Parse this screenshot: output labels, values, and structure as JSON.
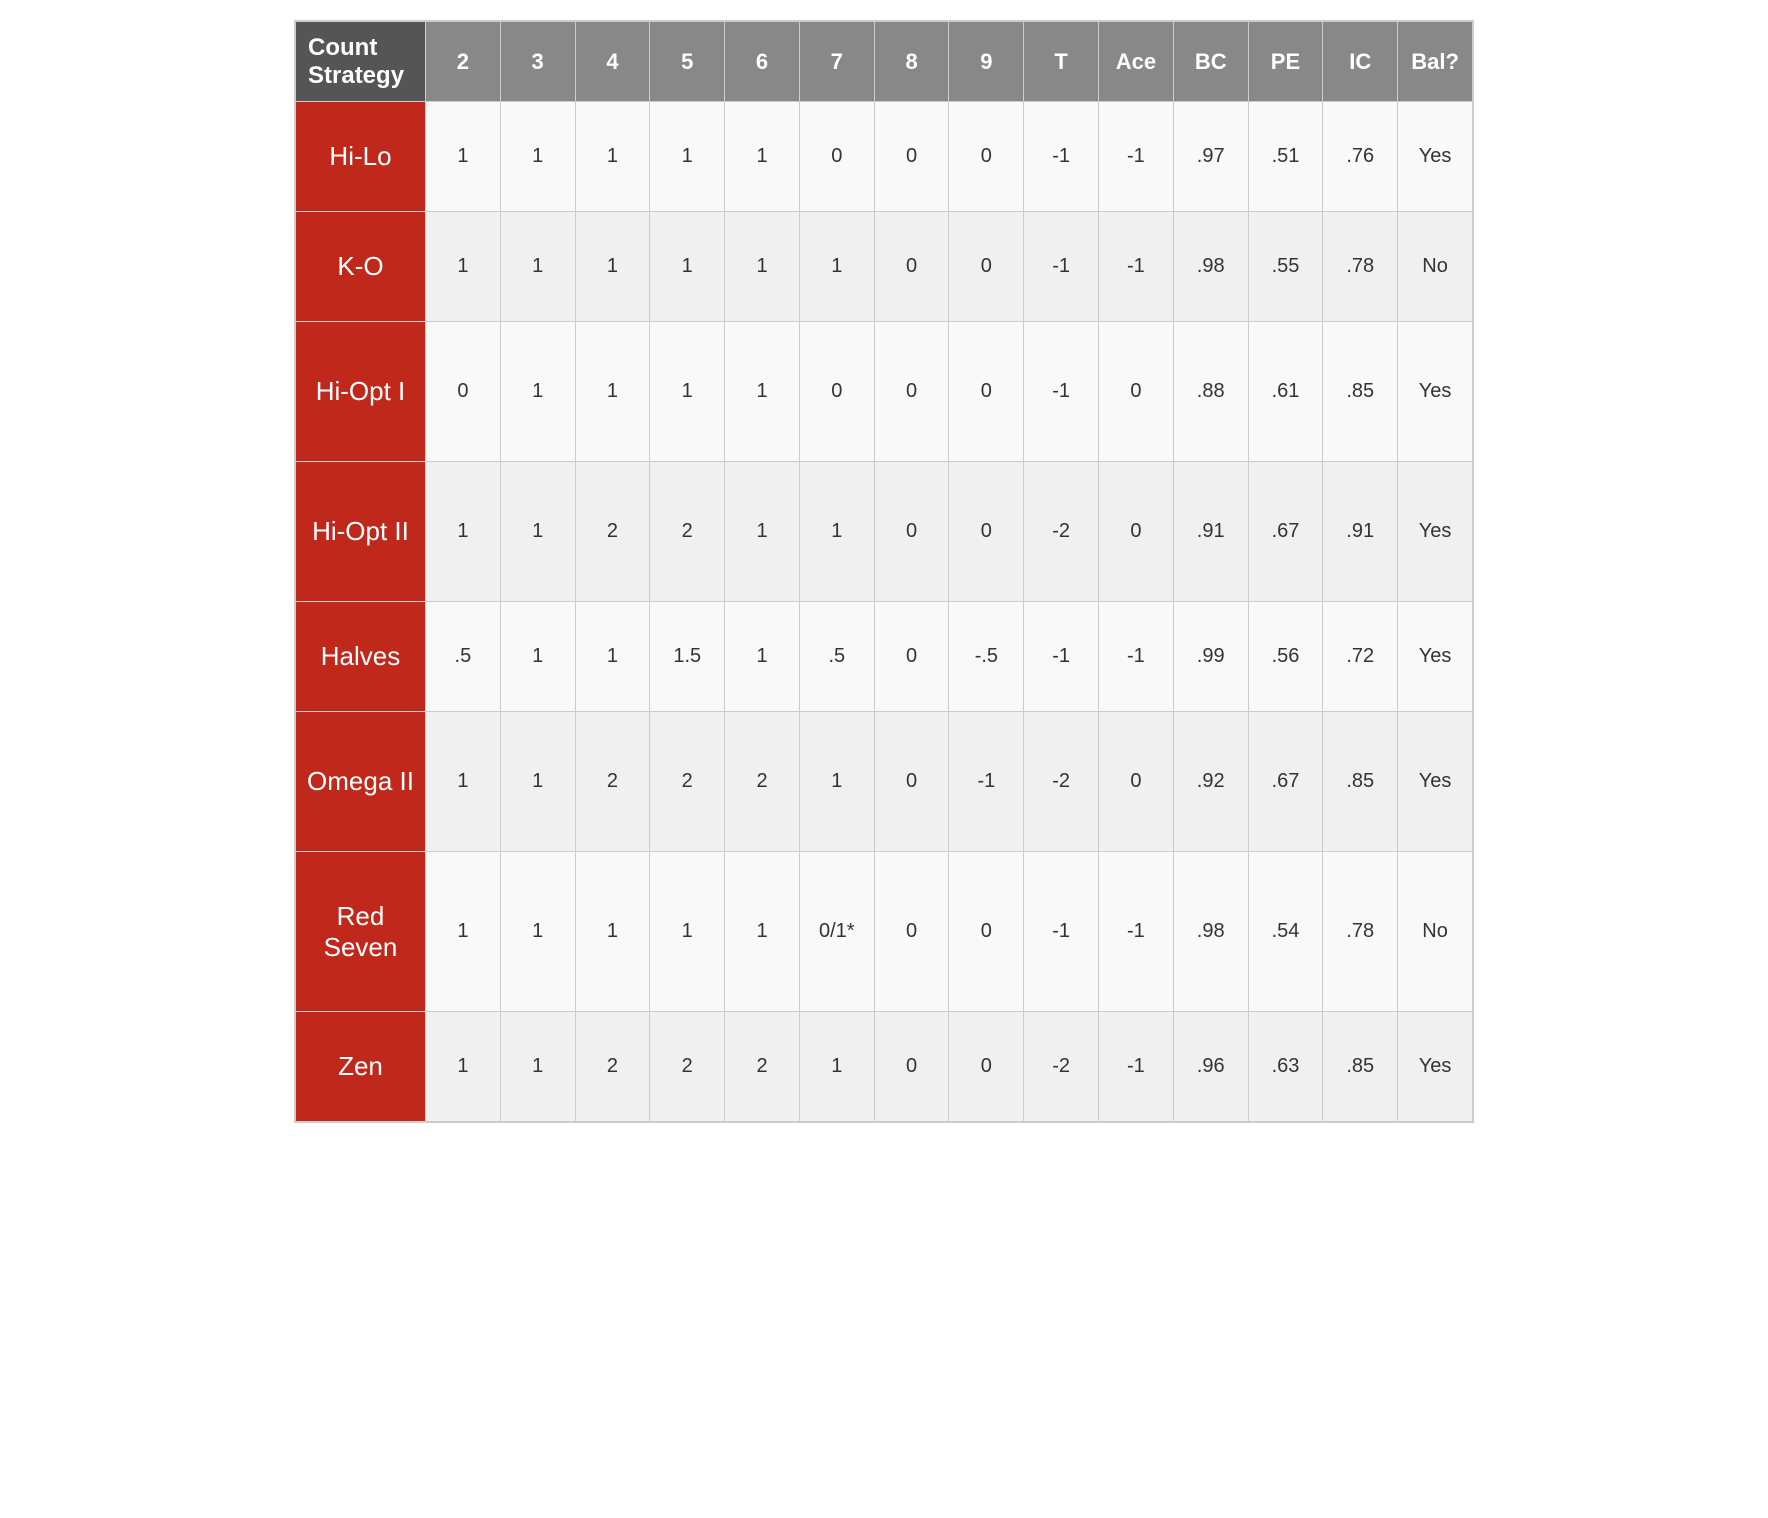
{
  "table": {
    "headers": [
      {
        "key": "count_strategy",
        "label": "Count Strategy"
      },
      {
        "key": "two",
        "label": "2"
      },
      {
        "key": "three",
        "label": "3"
      },
      {
        "key": "four",
        "label": "4"
      },
      {
        "key": "five",
        "label": "5"
      },
      {
        "key": "six",
        "label": "6"
      },
      {
        "key": "seven",
        "label": "7"
      },
      {
        "key": "eight",
        "label": "8"
      },
      {
        "key": "nine",
        "label": "9"
      },
      {
        "key": "ten",
        "label": "T"
      },
      {
        "key": "ace",
        "label": "Ace"
      },
      {
        "key": "bc",
        "label": "BC"
      },
      {
        "key": "pe",
        "label": "PE"
      },
      {
        "key": "ic",
        "label": "IC"
      },
      {
        "key": "bal",
        "label": "Bal?"
      }
    ],
    "rows": [
      {
        "strategy": "Hi-Lo",
        "two": "1",
        "three": "1",
        "four": "1",
        "five": "1",
        "six": "1",
        "seven": "0",
        "eight": "0",
        "nine": "0",
        "ten": "-1",
        "ace": "-1",
        "bc": ".97",
        "pe": ".51",
        "ic": ".76",
        "bal": "Yes"
      },
      {
        "strategy": "K-O",
        "two": "1",
        "three": "1",
        "four": "1",
        "five": "1",
        "six": "1",
        "seven": "1",
        "eight": "0",
        "nine": "0",
        "ten": "-1",
        "ace": "-1",
        "bc": ".98",
        "pe": ".55",
        "ic": ".78",
        "bal": "No"
      },
      {
        "strategy": "Hi-Opt I",
        "two": "0",
        "three": "1",
        "four": "1",
        "five": "1",
        "six": "1",
        "seven": "0",
        "eight": "0",
        "nine": "0",
        "ten": "-1",
        "ace": "0",
        "bc": ".88",
        "pe": ".61",
        "ic": ".85",
        "bal": "Yes"
      },
      {
        "strategy": "Hi-Opt II",
        "two": "1",
        "three": "1",
        "four": "2",
        "five": "2",
        "six": "1",
        "seven": "1",
        "eight": "0",
        "nine": "0",
        "ten": "-2",
        "ace": "0",
        "bc": ".91",
        "pe": ".67",
        "ic": ".91",
        "bal": "Yes"
      },
      {
        "strategy": "Halves",
        "two": ".5",
        "three": "1",
        "four": "1",
        "five": "1.5",
        "six": "1",
        "seven": ".5",
        "eight": "0",
        "nine": "-.5",
        "ten": "-1",
        "ace": "-1",
        "bc": ".99",
        "pe": ".56",
        "ic": ".72",
        "bal": "Yes"
      },
      {
        "strategy": "Omega II",
        "two": "1",
        "three": "1",
        "four": "2",
        "five": "2",
        "six": "2",
        "seven": "1",
        "eight": "0",
        "nine": "-1",
        "ten": "-2",
        "ace": "0",
        "bc": ".92",
        "pe": ".67",
        "ic": ".85",
        "bal": "Yes"
      },
      {
        "strategy": "Red Seven",
        "two": "1",
        "three": "1",
        "four": "1",
        "five": "1",
        "six": "1",
        "seven": "0/1*",
        "eight": "0",
        "nine": "0",
        "ten": "-1",
        "ace": "-1",
        "bc": ".98",
        "pe": ".54",
        "ic": ".78",
        "bal": "No"
      },
      {
        "strategy": "Zen",
        "two": "1",
        "three": "1",
        "four": "2",
        "five": "2",
        "six": "2",
        "seven": "1",
        "eight": "0",
        "nine": "0",
        "ten": "-2",
        "ace": "-1",
        "bc": ".96",
        "pe": ".63",
        "ic": ".85",
        "bal": "Yes"
      }
    ]
  }
}
